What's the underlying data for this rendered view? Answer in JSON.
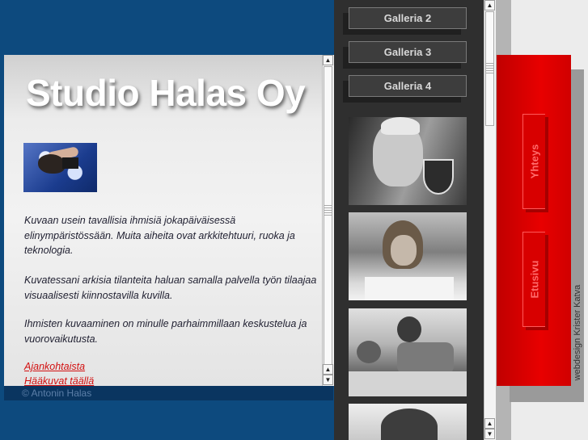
{
  "site": {
    "title": "Studio Halas Oy",
    "copyright": "© Antonin Halas",
    "webdesign": "webdesign Krister Katva"
  },
  "content": {
    "portrait_icon": "photographer-portrait-image",
    "paragraphs": [
      "Kuvaan usein tavallisia ihmisiä jokapäiväisessä elinympäristössään. Muita aiheita ovat arkkitehtuuri, ruoka ja teknologia.",
      "Kuvatessani arkisia tilanteita haluan samalla palvella työn tilaajaa visuaalisesti kiinnostavilla kuvilla.",
      "Ihmisten kuvaaminen on minulle parhaimmillaan keskustelua ja vuorovaikutusta."
    ],
    "links": [
      "Ajankohtaista",
      "Hääkuvat täällä"
    ]
  },
  "gallery": {
    "buttons": [
      "Galleria 2",
      "Galleria 3",
      "Galleria 4"
    ],
    "photos": [
      "man-with-wine-glass-photo",
      "girl-drawing-photo",
      "man-and-child-on-floor-photo",
      "woman-portrait-photo"
    ]
  },
  "nav": {
    "items": [
      "Yhteys",
      "Etusivu"
    ]
  },
  "colors": {
    "background": "#0d4a7e",
    "accent_red": "#e00000",
    "link_red": "#d21010"
  }
}
